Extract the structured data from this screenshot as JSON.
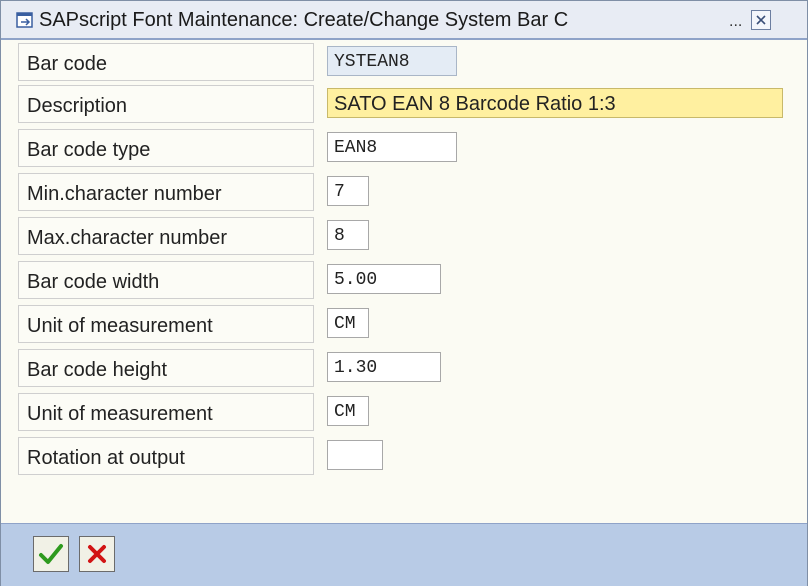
{
  "window": {
    "title": "SAPscript Font Maintenance: Create/Change System Bar C",
    "title_ellipsis": "...",
    "icons": {
      "title": "window-icon",
      "close": "close-icon"
    }
  },
  "form": {
    "fields": [
      {
        "label": "Bar code",
        "value": "YSTEAN8",
        "state": "readonly"
      },
      {
        "label": "Description",
        "value": "SATO EAN 8 Barcode Ratio 1:3",
        "state": "required"
      },
      {
        "label": "Bar code type",
        "value": "EAN8",
        "state": "editable"
      },
      {
        "label": "Min.character number",
        "value": "7",
        "state": "editable"
      },
      {
        "label": "Max.character number",
        "value": "8",
        "state": "editable"
      },
      {
        "label": "Bar code width",
        "value": "5.00",
        "state": "editable"
      },
      {
        "label": "Unit of measurement",
        "value": "CM",
        "state": "editable"
      },
      {
        "label": "Bar code height",
        "value": "1.30",
        "state": "editable"
      },
      {
        "label": "Unit of measurement",
        "value": "CM",
        "state": "editable"
      },
      {
        "label": "Rotation at output",
        "value": "",
        "state": "editable"
      }
    ]
  },
  "footer": {
    "buttons": [
      {
        "name": "confirm",
        "icon": "checkmark-icon"
      },
      {
        "name": "cancel",
        "icon": "cancel-x-icon"
      }
    ]
  },
  "colors": {
    "title_bar": "#e8ecf4",
    "footer_bar": "#b8cbe6",
    "readonly_field": "#e4ecf5",
    "required_field": "#fff0a0",
    "confirm_icon": "#2e9a1e",
    "cancel_icon": "#d21414"
  }
}
